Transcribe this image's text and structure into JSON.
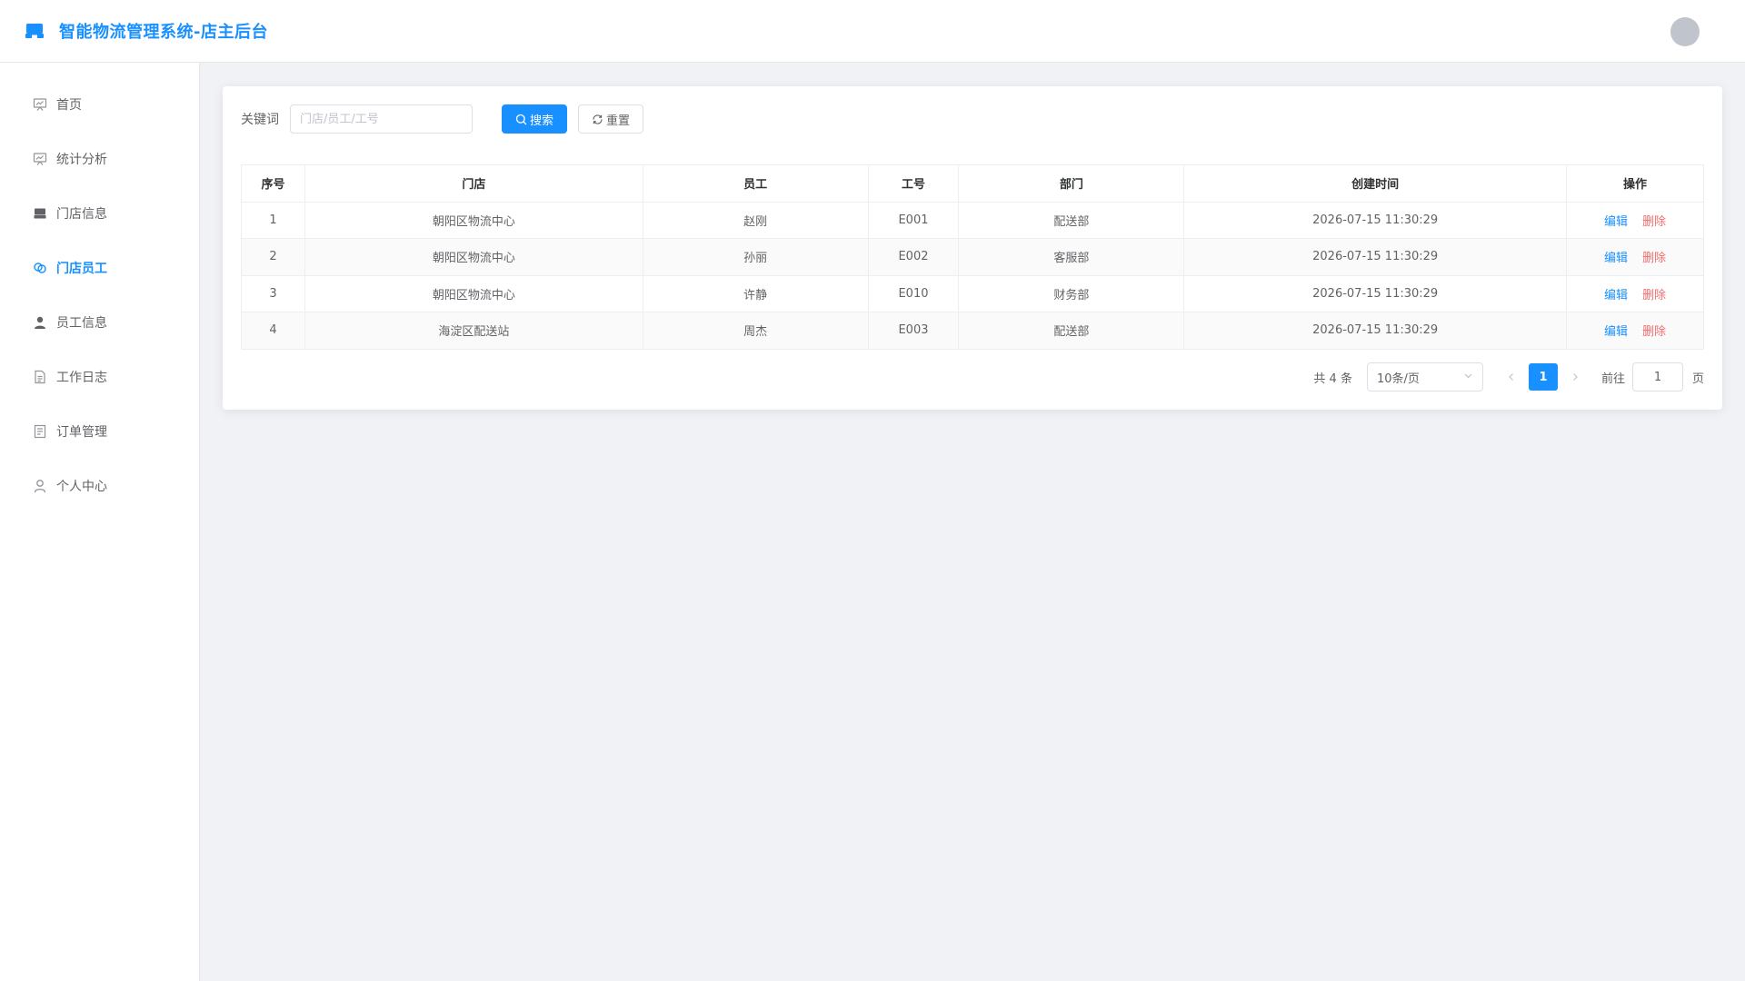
{
  "header": {
    "title": "智能物流管理系统-店主后台"
  },
  "sidebar": {
    "items": [
      {
        "label": "首页",
        "icon": "chart-board-icon",
        "active": false
      },
      {
        "label": "统计分析",
        "icon": "chart-board-icon",
        "active": false
      },
      {
        "label": "门店信息",
        "icon": "store-icon",
        "active": false
      },
      {
        "label": "门店员工",
        "icon": "link-icon",
        "active": true
      },
      {
        "label": "员工信息",
        "icon": "user-filled-icon",
        "active": false
      },
      {
        "label": "工作日志",
        "icon": "document-icon",
        "active": false
      },
      {
        "label": "订单管理",
        "icon": "list-document-icon",
        "active": false
      },
      {
        "label": "个人中心",
        "icon": "user-outline-icon",
        "active": false
      }
    ]
  },
  "search": {
    "label": "关键词",
    "placeholder": "门店/员工/工号",
    "value": "",
    "search_button": "搜索",
    "reset_button": "重置"
  },
  "table": {
    "headers": [
      "序号",
      "门店",
      "员工",
      "工号",
      "部门",
      "创建时间",
      "操作"
    ],
    "rows": [
      {
        "index": "1",
        "store": "朝阳区物流中心",
        "employee": "赵刚",
        "emp_no": "E001",
        "dept": "配送部",
        "created": "2026-07-15 11:30:29"
      },
      {
        "index": "2",
        "store": "朝阳区物流中心",
        "employee": "孙丽",
        "emp_no": "E002",
        "dept": "客服部",
        "created": "2026-07-15 11:30:29"
      },
      {
        "index": "3",
        "store": "朝阳区物流中心",
        "employee": "许静",
        "emp_no": "E010",
        "dept": "财务部",
        "created": "2026-07-15 11:30:29"
      },
      {
        "index": "4",
        "store": "海淀区配送站",
        "employee": "周杰",
        "emp_no": "E003",
        "dept": "配送部",
        "created": "2026-07-15 11:30:29"
      }
    ],
    "edit_label": "编辑",
    "delete_label": "删除"
  },
  "pagination": {
    "total_text": "共 4 条",
    "page_size": "10条/页",
    "current_page": "1",
    "goto_label": "前往",
    "goto_value": "1",
    "page_suffix": "页"
  },
  "colors": {
    "primary": "#1890ff",
    "danger": "#f56c6c",
    "background": "#f0f2f5"
  }
}
